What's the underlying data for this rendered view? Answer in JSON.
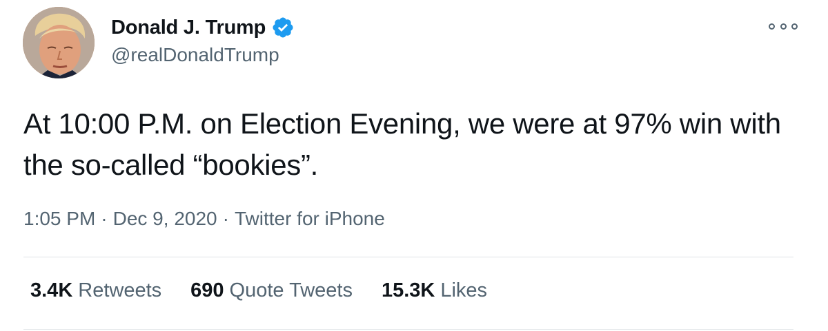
{
  "tweet": {
    "author": {
      "display_name": "Donald J. Trump",
      "handle": "@realDonaldTrump",
      "verified": true,
      "verified_color": "#1d9bf0"
    },
    "text": "At 10:00 P.M. on Election Evening, we were at 97% win with the so-called “bookies”.",
    "meta": {
      "time": "1:05 PM",
      "separator1": "·",
      "date": "Dec 9, 2020",
      "separator2": "·",
      "source": "Twitter for iPhone"
    },
    "stats": [
      {
        "count": "3.4K",
        "label": "Retweets"
      },
      {
        "count": "690",
        "label": "Quote Tweets"
      },
      {
        "count": "15.3K",
        "label": "Likes"
      }
    ],
    "icons": {
      "more": "more-options-icon",
      "verified": "verified-badge-icon"
    }
  }
}
